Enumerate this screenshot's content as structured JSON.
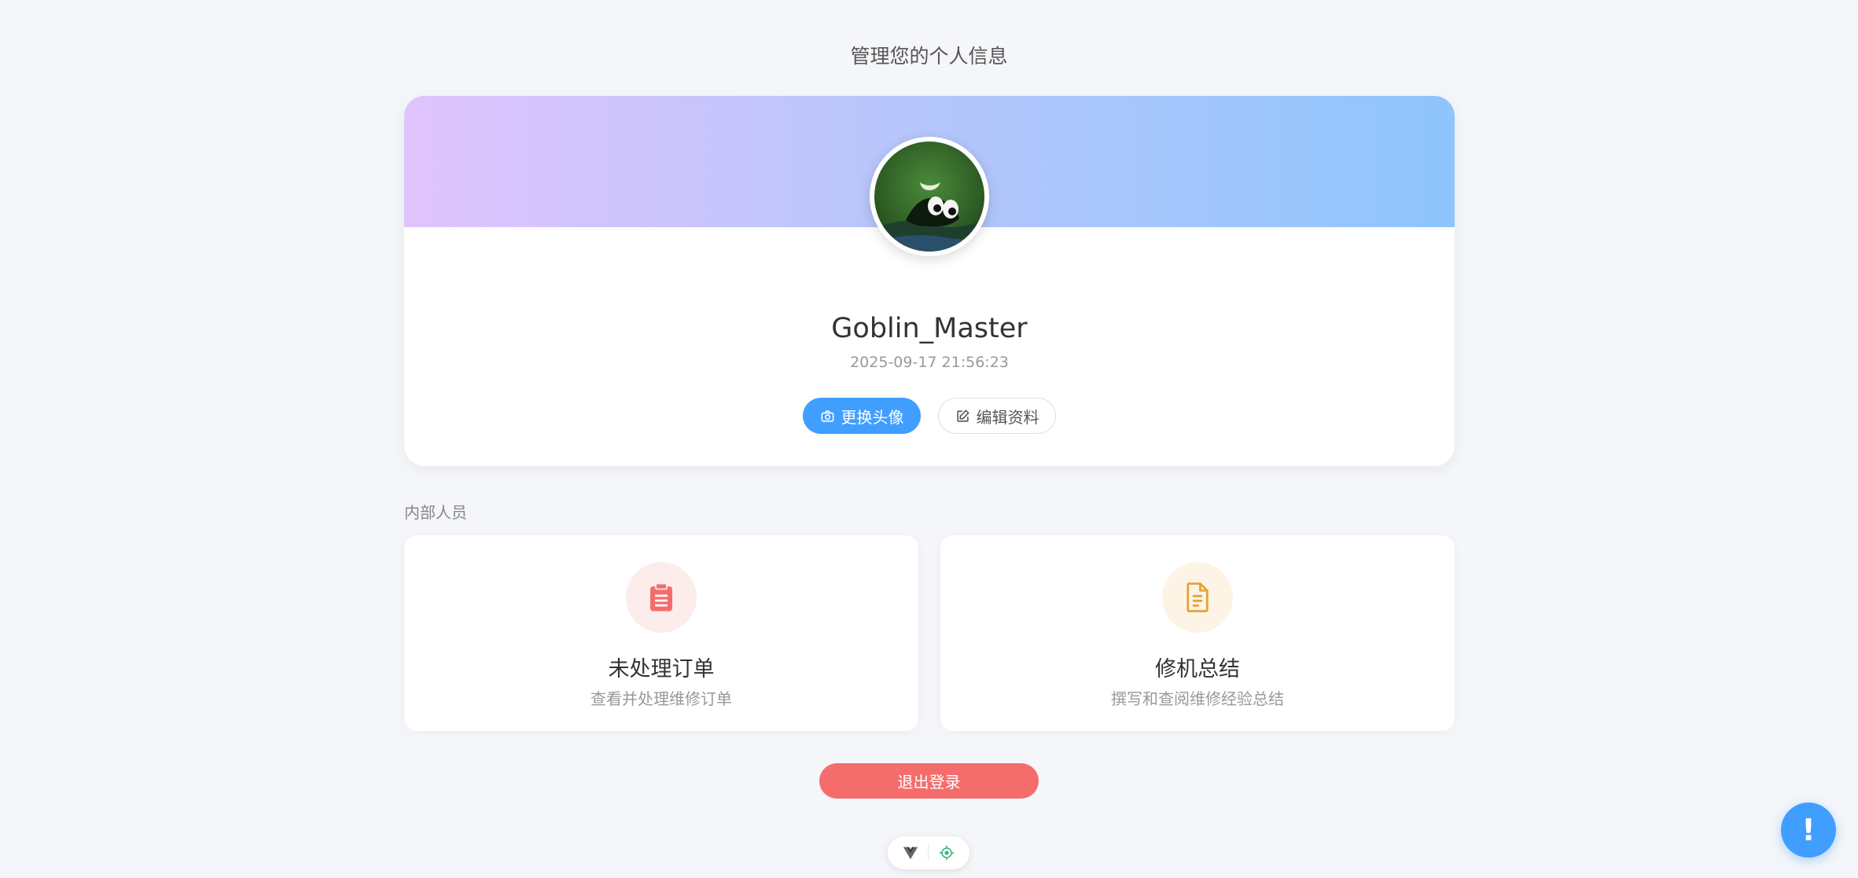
{
  "header": {
    "subtitle": "管理您的个人信息"
  },
  "profile": {
    "name": "Goblin_Master",
    "time": "2025-09-17 21:56:23",
    "change_avatar_label": "更换头像",
    "edit_profile_label": "编辑资料"
  },
  "section": {
    "label": "内部人员"
  },
  "cards": [
    {
      "title": "未处理订单",
      "desc": "查看并处理维修订单",
      "icon": "clipboard-icon",
      "color": "#f56c6c"
    },
    {
      "title": "修机总结",
      "desc": "撰写和查阅维修经验总结",
      "icon": "document-icon",
      "color": "#e6a23c"
    }
  ],
  "logout": {
    "label": "退出登录"
  },
  "fab": {
    "label": "!"
  },
  "colors": {
    "primary": "#409eff",
    "danger": "#f56c6c",
    "warning": "#e6a23c",
    "banner_start": "#e0c3fc",
    "banner_end": "#8ec5fc"
  }
}
